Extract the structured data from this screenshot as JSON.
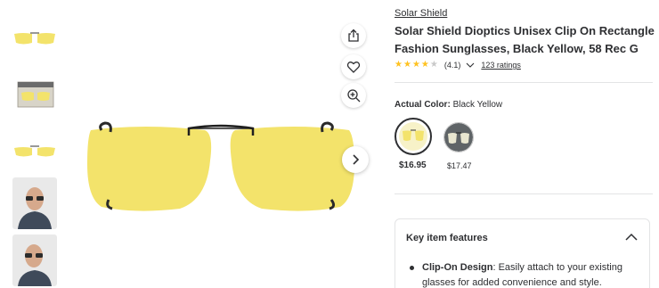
{
  "brand": "Solar Shield",
  "title": "Solar Shield Dioptics Unisex Clip On Rectangle Fashion Sunglasses, Black Yellow, 58 Rec G",
  "rating": {
    "value": 4.1,
    "value_text": "(4.1)",
    "stars_full": 4,
    "stars_total": 5,
    "count_text": "123 ratings"
  },
  "color": {
    "label": "Actual Color:",
    "value": "Black Yellow",
    "options": [
      {
        "name": "Black Yellow",
        "price": "$16.95",
        "selected": true
      },
      {
        "name": "Gray",
        "price": "$17.47",
        "selected": false
      }
    ]
  },
  "features": {
    "heading": "Key item features",
    "items": [
      {
        "title": "Clip-On Design",
        "text": ": Easily attach to your existing glasses for added convenience and style."
      }
    ]
  },
  "icons": {
    "share": "share-icon",
    "favorite": "heart-icon",
    "zoom": "zoom-in-icon",
    "next": "chevron-right-icon",
    "collapse": "chevron-up-icon"
  },
  "colors": {
    "lens_yellow": "#f3e36b",
    "star_yellow": "#ffc220",
    "text": "#2e2f32",
    "divider": "#e3e4e5"
  }
}
